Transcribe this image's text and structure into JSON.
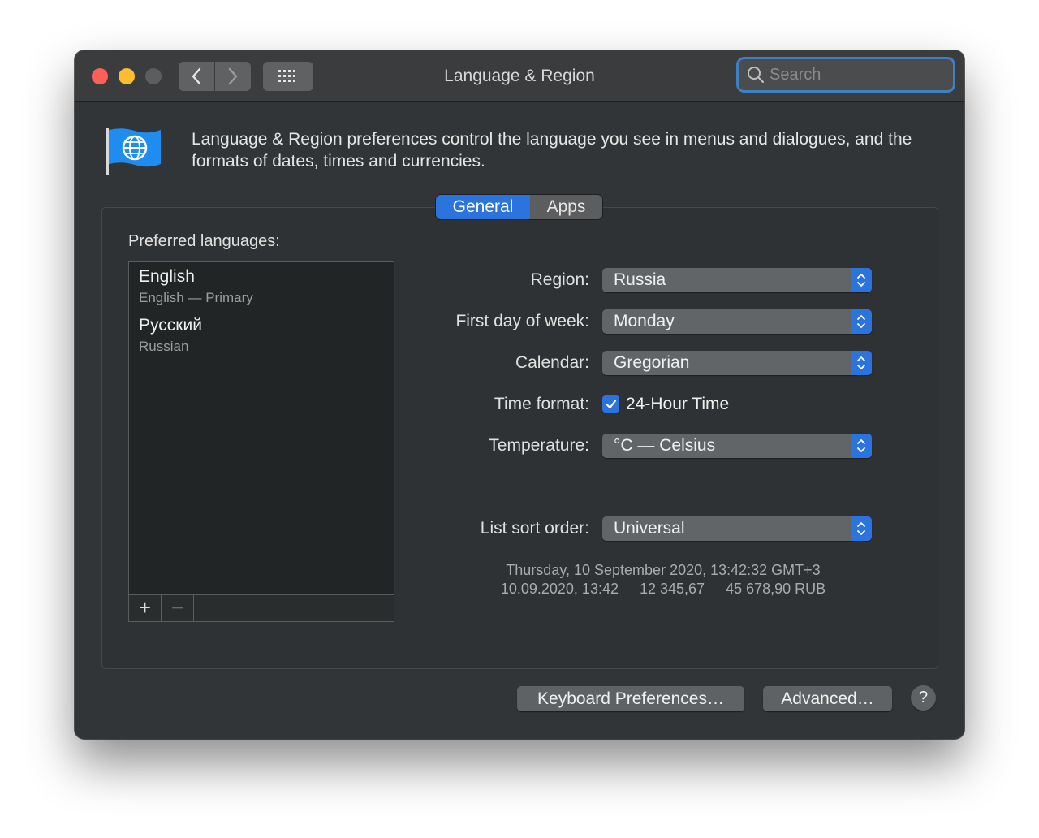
{
  "window": {
    "title": "Language & Region"
  },
  "toolbar": {
    "back_icon": "chevron-left-icon",
    "forward_icon": "chevron-right-icon",
    "grid_icon": "grid-icon"
  },
  "search": {
    "placeholder": "Search",
    "value": ""
  },
  "header": {
    "icon": "flag-globe-icon",
    "description": "Language & Region preferences control the language you see in menus and dialogues, and the formats of dates, times and currencies."
  },
  "tabs": [
    {
      "label": "General",
      "active": true
    },
    {
      "label": "Apps",
      "active": false
    }
  ],
  "languages": {
    "title": "Preferred languages:",
    "items": [
      {
        "name": "English",
        "sub": "English — Primary"
      },
      {
        "name": "Русский",
        "sub": "Russian"
      }
    ],
    "add_label": "+",
    "remove_label": "−"
  },
  "form": {
    "region": {
      "label": "Region:",
      "value": "Russia"
    },
    "first_day": {
      "label": "First day of week:",
      "value": "Monday"
    },
    "calendar": {
      "label": "Calendar:",
      "value": "Gregorian"
    },
    "time_format": {
      "label": "Time format:",
      "checkbox_label": "24-Hour Time",
      "checked": true
    },
    "temperature": {
      "label": "Temperature:",
      "value": "°C — Celsius"
    },
    "sort_order": {
      "label": "List sort order:",
      "value": "Universal"
    }
  },
  "sample": {
    "date_long": "Thursday, 10 September 2020, 13:42:32 GMT+3",
    "date_short": "10.09.2020, 13:42",
    "number": "12 345,67",
    "currency": "45 678,90 RUB"
  },
  "buttons": {
    "keyboard": "Keyboard Preferences…",
    "advanced": "Advanced…",
    "help": "?"
  },
  "colors": {
    "accent": "#2b74de",
    "window_bg": "#323537",
    "close": "#fe5f57",
    "minimize": "#febc2e"
  }
}
